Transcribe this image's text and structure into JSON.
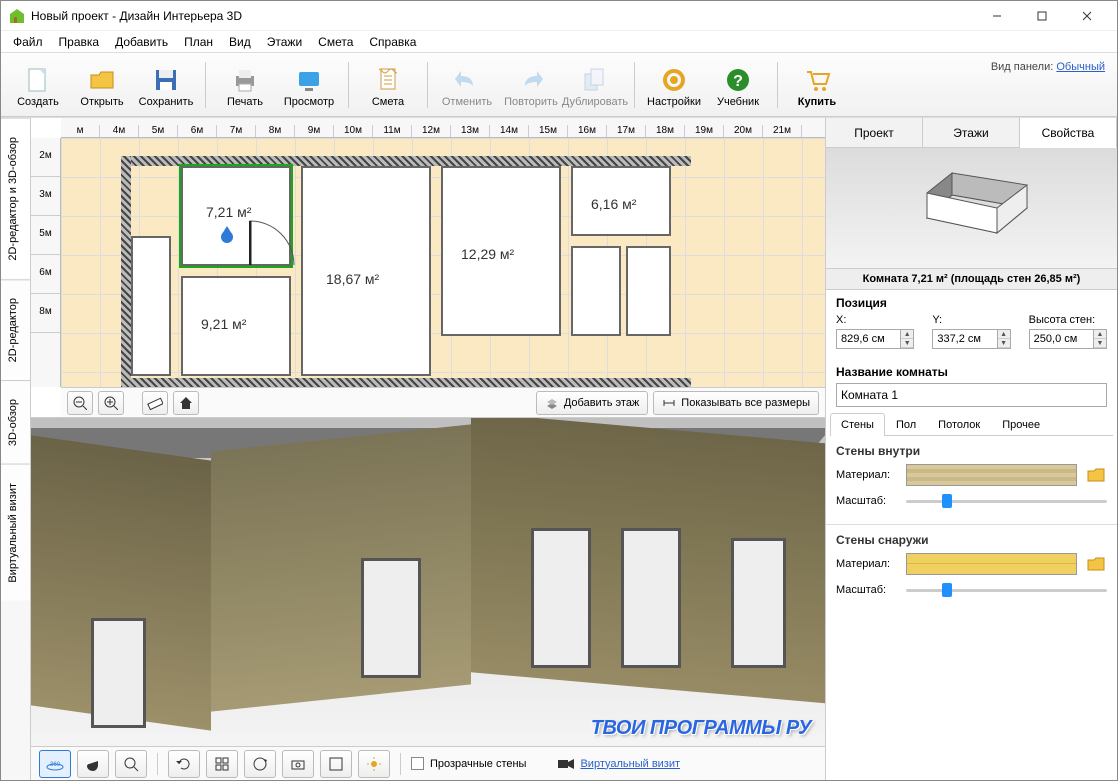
{
  "window": {
    "title": "Новый проект - Дизайн Интерьера 3D"
  },
  "menu": [
    "Файл",
    "Правка",
    "Добавить",
    "План",
    "Вид",
    "Этажи",
    "Смета",
    "Справка"
  ],
  "toolbar": {
    "create": "Создать",
    "open": "Открыть",
    "save": "Сохранить",
    "print": "Печать",
    "preview": "Просмотр",
    "estimate": "Смета",
    "undo": "Отменить",
    "redo": "Повторить",
    "duplicate": "Дублировать",
    "settings": "Настройки",
    "tutorial": "Учебник",
    "buy": "Купить",
    "panel_label": "Вид панели:",
    "panel_mode": "Обычный"
  },
  "vtabs": {
    "combo": "2D-редактор и 3D-обзор",
    "edit2d": "2D-редактор",
    "view3d": "3D-обзор",
    "tour": "Виртуальный визит"
  },
  "ruler_h": [
    "м",
    "4м",
    "5м",
    "6м",
    "7м",
    "8м",
    "9м",
    "10м",
    "11м",
    "12м",
    "13м",
    "14м",
    "15м",
    "16м",
    "17м",
    "18м",
    "19м",
    "20м",
    "21м"
  ],
  "ruler_v": [
    "2м",
    "3м",
    "5м",
    "6м",
    "8м"
  ],
  "rooms": {
    "r1": "7,21 м²",
    "r2": "6,16 м²",
    "r3": "18,67 м²",
    "r4": "12,29 м²",
    "r5": "9,21 м²"
  },
  "planbar": {
    "addfloor": "Добавить этаж",
    "showdims": "Показывать все размеры"
  },
  "bottombar": {
    "transp": "Прозрачные стены",
    "tour": "Виртуальный визит"
  },
  "side": {
    "tabs": {
      "project": "Проект",
      "floors": "Этажи",
      "props": "Свойства"
    },
    "room_info": "Комната 7,21 м²  (площадь стен 26,85 м²)",
    "pos_label": "Позиция",
    "x_label": "X:",
    "y_label": "Y:",
    "h_label": "Высота стен:",
    "x": "829,6 см",
    "y": "337,2 см",
    "h": "250,0 см",
    "name_label": "Название комнаты",
    "name": "Комната 1",
    "subtabs": {
      "walls": "Стены",
      "floor": "Пол",
      "ceil": "Потолок",
      "other": "Прочее"
    },
    "inner_title": "Стены внутри",
    "outer_title": "Стены снаружи",
    "mat_label": "Материал:",
    "scale_label": "Масштаб:"
  },
  "watermark": "ТВОИ ПРОГРАММЫ РУ"
}
